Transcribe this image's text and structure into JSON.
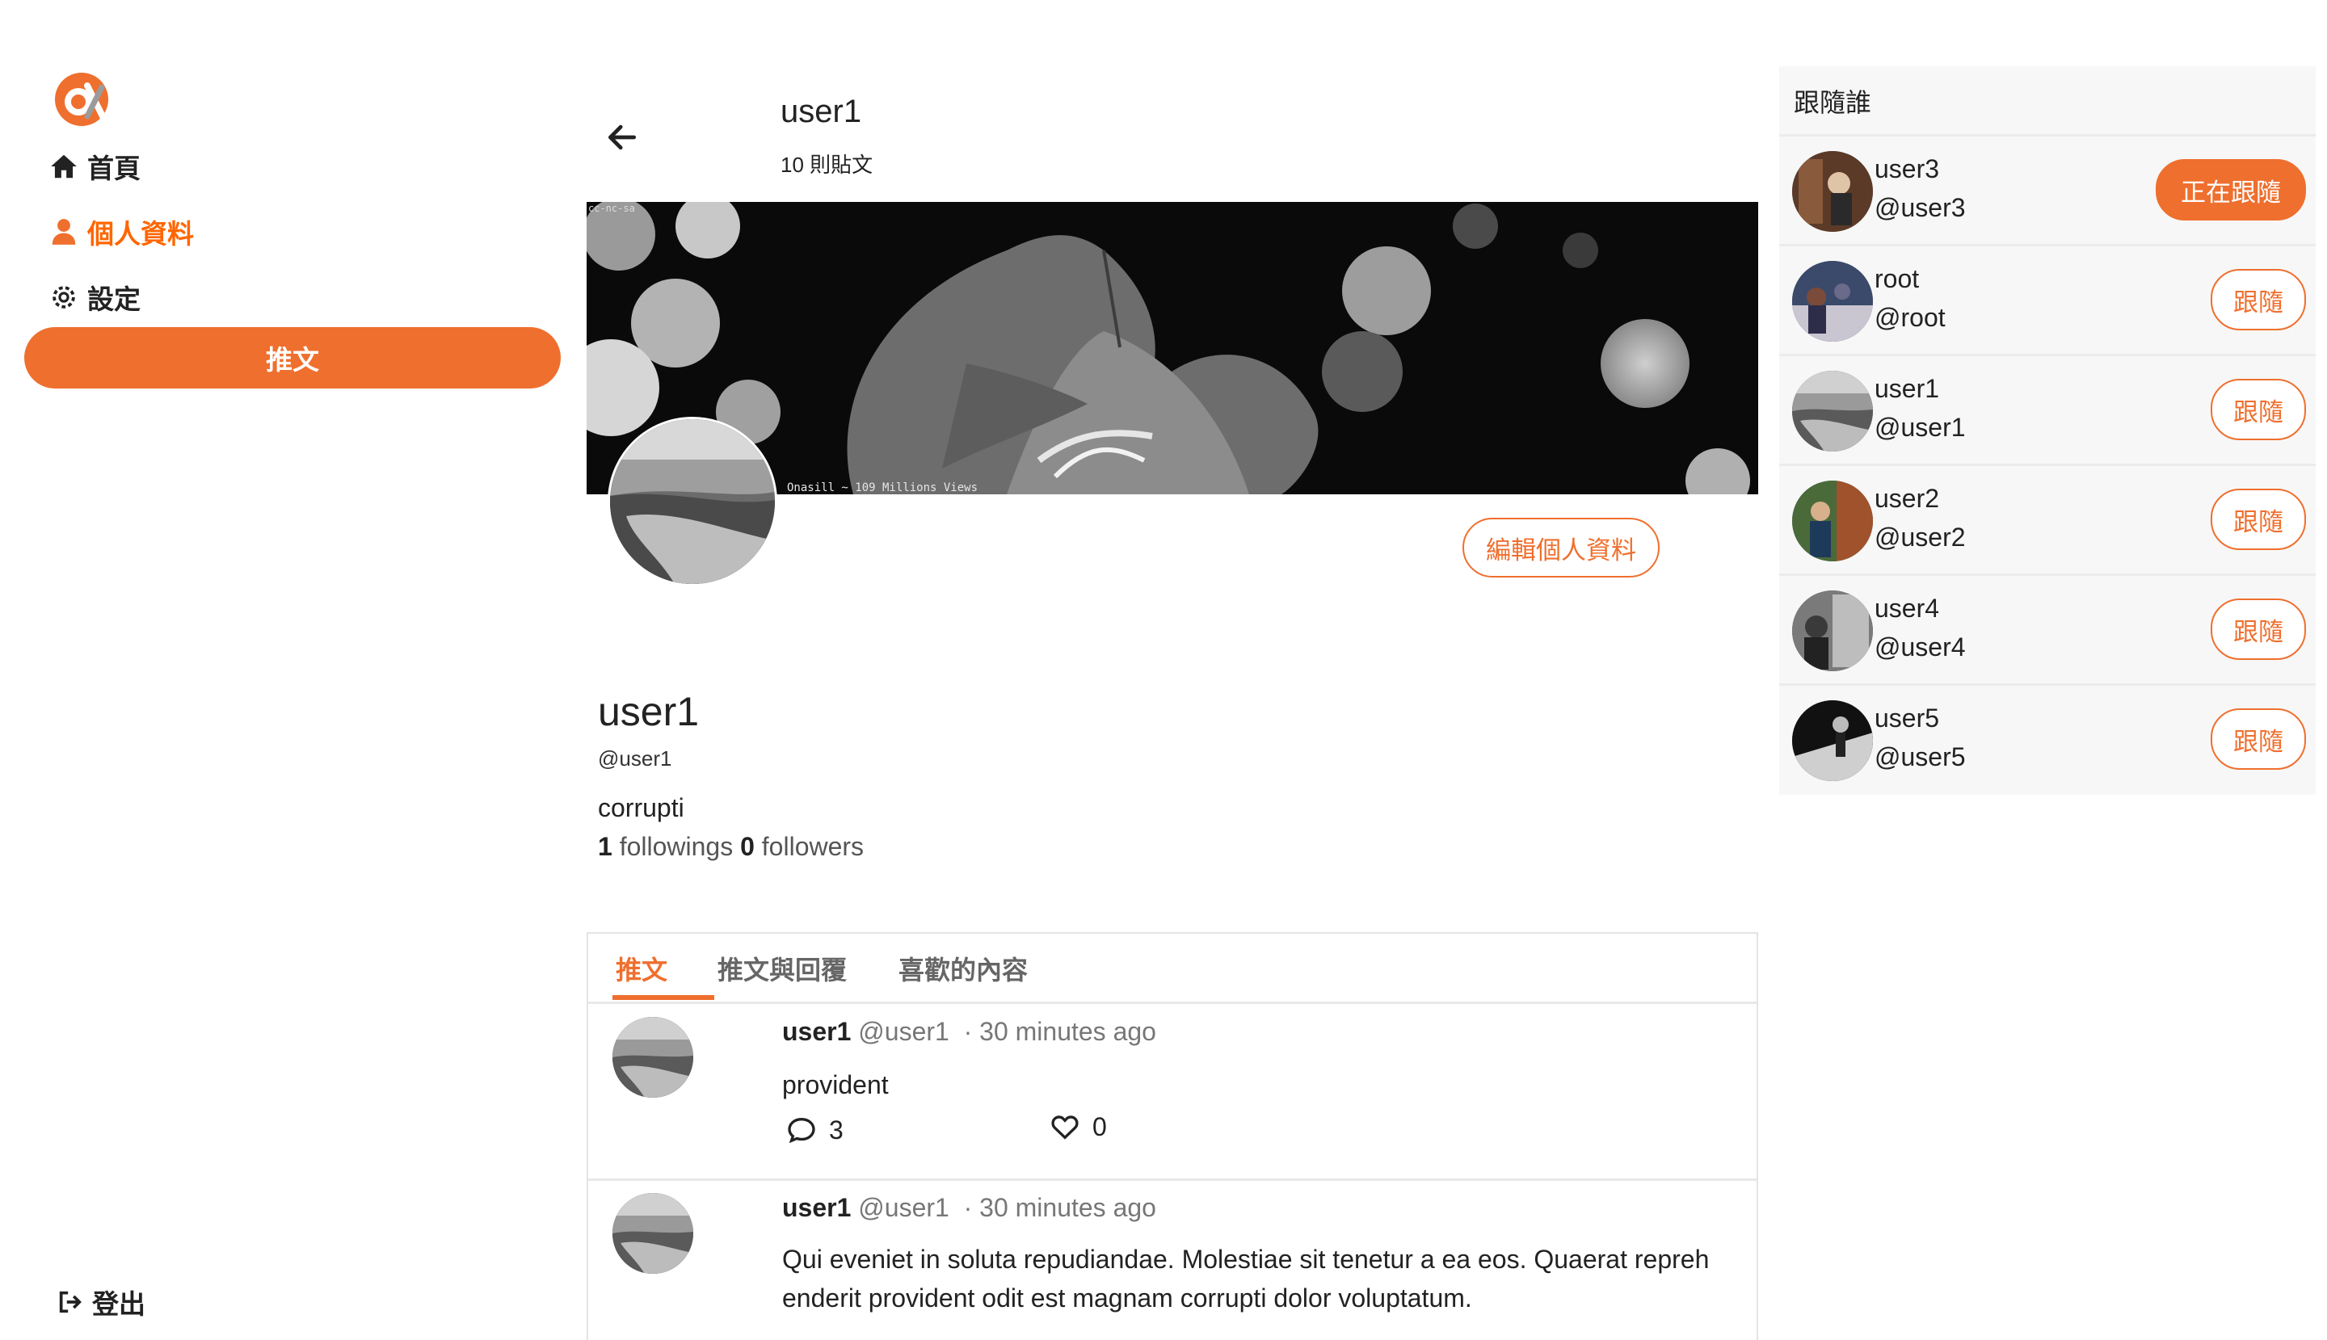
{
  "colors": {
    "accent": "#ef6f2e",
    "panel": "#f7f7f7"
  },
  "nav": {
    "logo_icon": "alpha-logo-icon",
    "items": [
      {
        "label": "首頁",
        "icon": "home-icon",
        "active": false
      },
      {
        "label": "個人資料",
        "icon": "user-icon",
        "active": true
      },
      {
        "label": "設定",
        "icon": "gear-icon",
        "active": false
      }
    ],
    "tweet_button": "推文",
    "logout": "登出"
  },
  "header": {
    "name": "user1",
    "post_count": "10 則貼文"
  },
  "banner": {
    "watermark_tl": "cc-nc-sa",
    "watermark_bottom": "Onasill ~ 109 Millions Views"
  },
  "profile": {
    "edit_button": "編輯個人資料",
    "name": "user1",
    "handle": "@user1",
    "bio": "corrupti",
    "followings_count": "1",
    "followings_label": "followings",
    "followers_count": "0",
    "followers_label": "followers"
  },
  "tabs": [
    {
      "label": "推文",
      "active": true
    },
    {
      "label": "推文與回覆",
      "active": false
    },
    {
      "label": "喜歡的內容",
      "active": false
    }
  ],
  "tweets": [
    {
      "name": "user1",
      "handle": "@user1",
      "time": "· 30 minutes ago",
      "text": "provident",
      "replies": "3",
      "likes": "0"
    },
    {
      "name": "user1",
      "handle": "@user1",
      "time": "· 30 minutes ago",
      "text": "Qui eveniet in soluta repudiandae. Molestiae sit tenetur a ea eos. Quaerat repreh enderit provident odit est magnam corrupti dolor voluptatum."
    }
  ],
  "follow_panel": {
    "title": "跟隨誰",
    "users": [
      {
        "name": "user3",
        "handle": "@user3",
        "button": "正在跟隨",
        "following": true
      },
      {
        "name": "root",
        "handle": "@root",
        "button": "跟隨",
        "following": false
      },
      {
        "name": "user1",
        "handle": "@user1",
        "button": "跟隨",
        "following": false
      },
      {
        "name": "user2",
        "handle": "@user2",
        "button": "跟隨",
        "following": false
      },
      {
        "name": "user4",
        "handle": "@user4",
        "button": "跟隨",
        "following": false
      },
      {
        "name": "user5",
        "handle": "@user5",
        "button": "跟隨",
        "following": false
      }
    ]
  }
}
